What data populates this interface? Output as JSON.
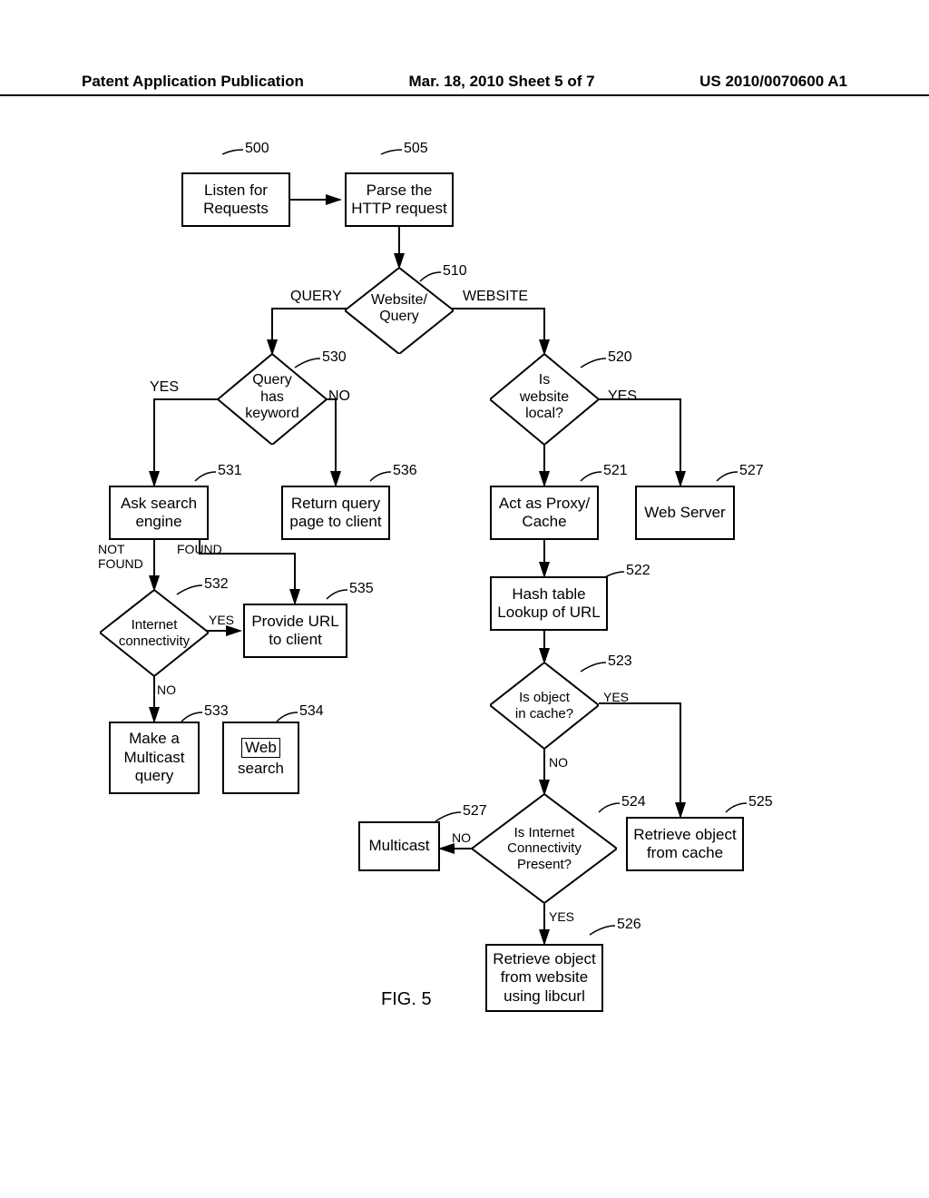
{
  "header": {
    "left": "Patent Application Publication",
    "center": "Mar. 18, 2010  Sheet 5 of 7",
    "right": "US 2010/0070600 A1"
  },
  "refs": {
    "r500": "500",
    "r505": "505",
    "r510": "510",
    "r520": "520",
    "r521": "521",
    "r522": "522",
    "r523": "523",
    "r524": "524",
    "r525": "525",
    "r526": "526",
    "r527a": "527",
    "r527b": "527",
    "r530": "530",
    "r531": "531",
    "r532": "532",
    "r533": "533",
    "r534": "534",
    "r535": "535",
    "r536": "536"
  },
  "boxes": {
    "b500": "Listen for\nRequests",
    "b505": "Parse the\nHTTP request",
    "b521": "Act as Proxy/\nCache",
    "b522": "Hash table\nLookup of URL",
    "b525": "Retrieve object\nfrom cache",
    "b526": "Retrieve object\nfrom website\nusing libcurl",
    "b527a": "Web Server",
    "b527b": "Multicast",
    "b531": "Ask search\nengine",
    "b533": "Make a\nMulticast\nquery",
    "b534_inner": "Web",
    "b534_text": "search",
    "b535": "Provide URL\nto client",
    "b536": "Return query\npage to client"
  },
  "diamonds": {
    "d510": "Website/\nQuery",
    "d520": "Is\nwebsite\nlocal?",
    "d523": "Is object\nin cache?",
    "d524": "Is Internet\nConnectivity\nPresent?",
    "d530": "Query\nhas\nkeyword",
    "d532": "Internet\nconnectivity"
  },
  "labels": {
    "query": "QUERY",
    "website": "WEBSITE",
    "yes": "YES",
    "no": "NO",
    "found": "FOUND",
    "notfound": "NOT\nFOUND"
  },
  "figure": "FIG. 5"
}
